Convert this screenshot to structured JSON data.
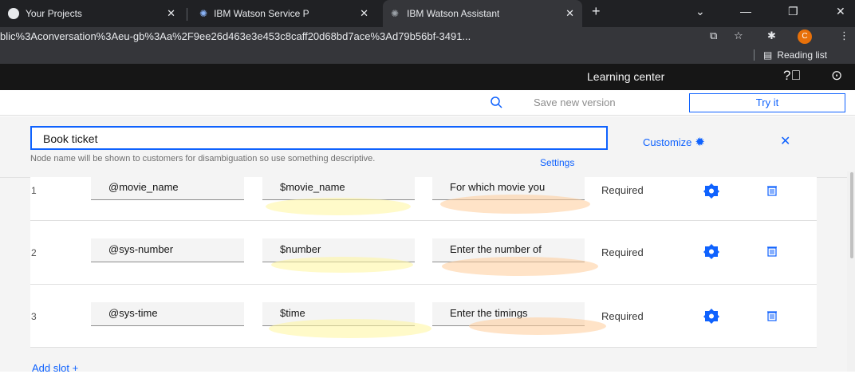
{
  "browser": {
    "tabs": [
      {
        "title": "Your Projects",
        "active": false
      },
      {
        "title": "IBM Watson Service P",
        "active": false
      },
      {
        "title": "IBM Watson Assistant",
        "active": true
      }
    ],
    "new_tab": "+",
    "url": "blic%3Aconversation%3Aeu-gb%3Aa%2F9ee26d463e3e453c8caff20d68bd7ace%3Ad79b56bf-3491...",
    "profile_initial": "C",
    "reading_list": "Reading list"
  },
  "app_header": {
    "learning_center": "Learning center"
  },
  "toolbar": {
    "save_version": "Save new version",
    "try_it": "Try it"
  },
  "node": {
    "name_value": "Book ticket",
    "helper": "Node name will be shown to customers for disambiguation so use something descriptive.",
    "settings": "Settings",
    "customize": "Customize"
  },
  "slots": [
    {
      "num": "1",
      "check_for": "@movie_name",
      "save_as": "$movie_name",
      "prompt": "For which movie you",
      "status": "Required"
    },
    {
      "num": "2",
      "check_for": "@sys-number",
      "save_as": "$number",
      "prompt": "Enter the number of",
      "status": "Required"
    },
    {
      "num": "3",
      "check_for": "@sys-time",
      "save_as": "$time",
      "prompt": "Enter the timings",
      "status": "Required"
    }
  ],
  "add_slot": "Add slot  +",
  "colors": {
    "accent": "#0f62fe",
    "header": "#161616",
    "highlight_yellow": "#fff59d",
    "highlight_orange": "#ffcc99"
  }
}
